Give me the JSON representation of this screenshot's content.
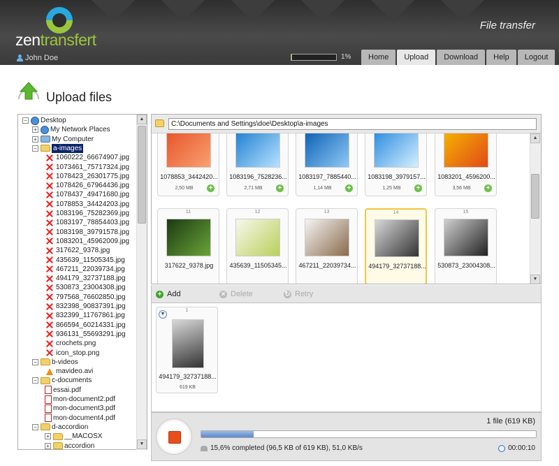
{
  "header": {
    "logo_prefix": "zen",
    "logo_suffix": "transfert",
    "app_title": "File transfer",
    "user_name": "John Doe",
    "quota_percent": 1,
    "quota_label": "1%",
    "nav": [
      {
        "label": "Home"
      },
      {
        "label": "Upload",
        "active": true
      },
      {
        "label": "Download"
      },
      {
        "label": "Help"
      },
      {
        "label": "Logout"
      }
    ]
  },
  "page": {
    "title": "Upload files"
  },
  "tree": {
    "root": "Desktop",
    "network": "My Network Places",
    "computer": "My Computer",
    "folder_a": "a-images",
    "images": [
      "1060222_66674907.jpg",
      "1073461_75717324.jpg",
      "1078423_26301775.jpg",
      "1078426_67964436.jpg",
      "1078437_49471680.jpg",
      "1078853_34424203.jpg",
      "1083196_75282369.jpg",
      "1083197_78854403.jpg",
      "1083198_39791578.jpg",
      "1083201_45962009.jpg",
      "317622_9378.jpg",
      "435639_11505345.jpg",
      "467211_22039734.jpg",
      "494179_32737188.jpg",
      "530873_23004308.jpg",
      "797568_76602850.jpg",
      "832398_90837391.jpg",
      "832399_11767861.jpg",
      "866594_60214331.jpg",
      "936131_55693291.jpg",
      "crochets.png",
      "icon_stop.png"
    ],
    "folder_b": "b-videos",
    "video": "mavideo.avi",
    "folder_c": "c-documents",
    "documents": [
      "essai.pdf",
      "mon-document2.pdf",
      "mon-document3.pdf",
      "mon-document4.pdf"
    ],
    "folder_d": "d-accordion",
    "sub_d": [
      "__MACOSX",
      "accordion"
    ]
  },
  "browser": {
    "path": "C:\\Documents and Settings\\doe\\Desktop\\a-images",
    "cards": [
      {
        "num": "",
        "caption": "1078853_3442420...",
        "size": "2,50 MB",
        "colors": [
          "#e8542a",
          "#f9a070"
        ]
      },
      {
        "num": "",
        "caption": "1083196_7528236...",
        "size": "2,71 MB",
        "colors": [
          "#1f7fd1",
          "#b7e2ff"
        ]
      },
      {
        "num": "",
        "caption": "1083197_7885440...",
        "size": "1,14 MB",
        "colors": [
          "#0b5fb5",
          "#8fcaf5"
        ]
      },
      {
        "num": "",
        "caption": "1083198_3979157...",
        "size": "1,25 MB",
        "colors": [
          "#2a8be0",
          "#d5efff"
        ]
      },
      {
        "num": "",
        "caption": "1083201_4596200...",
        "size": "3,56 MB",
        "colors": [
          "#f5b400",
          "#e14a18"
        ]
      },
      {
        "num": "11",
        "caption": "317622_9378.jpg",
        "size": "",
        "colors": [
          "#1c3a12",
          "#6aa43a"
        ]
      },
      {
        "num": "12",
        "caption": "435639_11505345...",
        "size": "",
        "colors": [
          "#f8f8ec",
          "#b9cf5a"
        ]
      },
      {
        "num": "13",
        "caption": "467211_22039734...",
        "size": "",
        "colors": [
          "#f4f4f4",
          "#8a6a4a"
        ]
      },
      {
        "num": "14",
        "caption": "494179_32737188...",
        "size": "",
        "colors": [
          "#d8d8d8",
          "#333333"
        ],
        "highlight": true
      },
      {
        "num": "15",
        "caption": "530873_23004308...",
        "size": "",
        "colors": [
          "#cfcfcf",
          "#222222"
        ]
      }
    ]
  },
  "toolbar": {
    "add": "Add",
    "delete": "Delete",
    "retry": "Retry"
  },
  "queue": [
    {
      "num": "1",
      "caption": "494179_32737188...",
      "size": "619 KB",
      "colors": [
        "#d8d8d8",
        "#333333"
      ]
    }
  ],
  "status": {
    "file_count": "1 file (619 KB)",
    "progress_percent": 15.6,
    "progress_text": "15,6% completed  (96,5 KB of 619 KB), 51,0 KB/s",
    "elapsed": "00:00:10"
  },
  "colors": {
    "brand_green": "#9bc53d",
    "brand_blue": "#27a9e0",
    "stop_red": "#ea4e1b",
    "highlight": "#f4c542"
  }
}
